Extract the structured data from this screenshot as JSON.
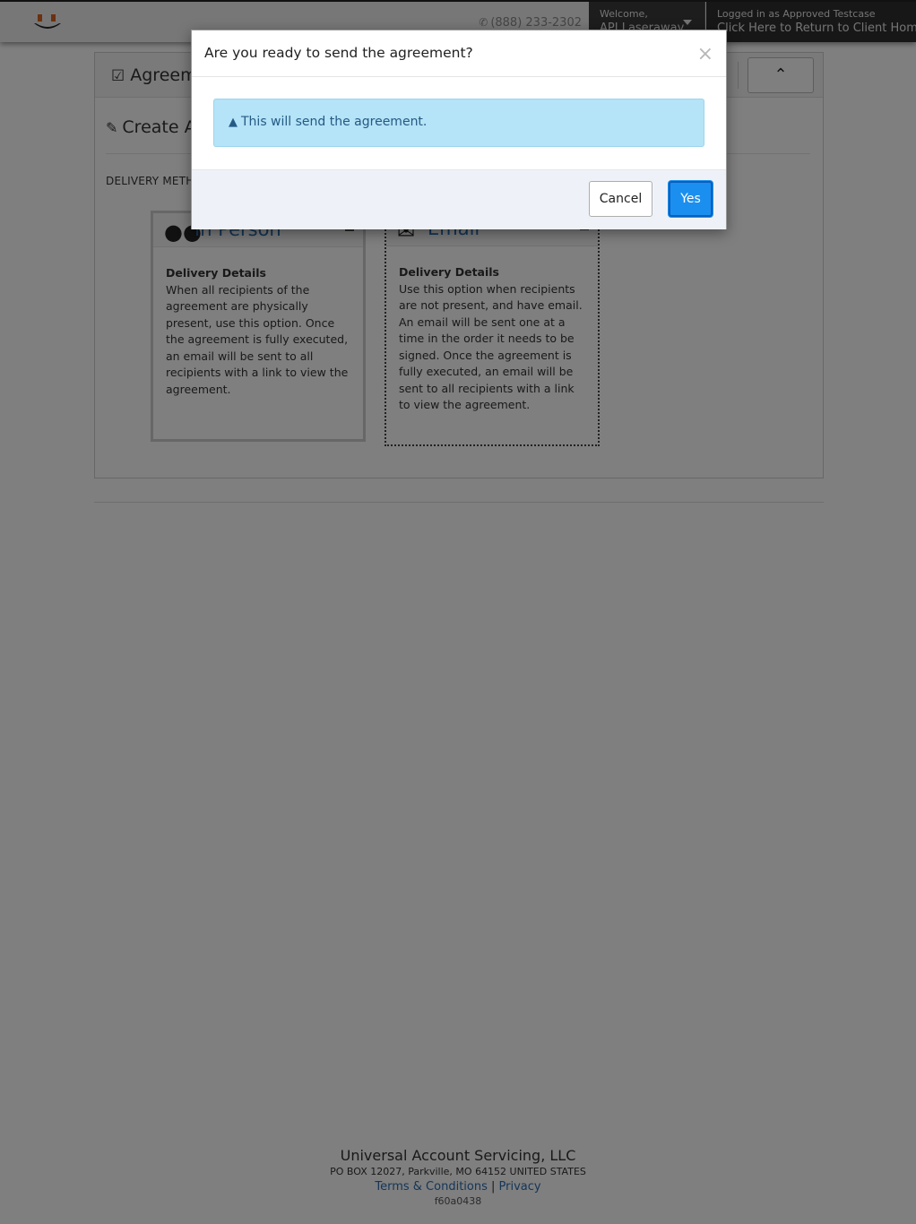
{
  "header": {
    "phone": "(888) 233-2302",
    "welcome_label": "Welcome,",
    "user_name": "API Laseraway",
    "logged_in_label": "Logged in as Approved Testcase",
    "return_link": "Click Here to Return to Client Home"
  },
  "panel": {
    "title": "Agreements",
    "subtitle": "Create Agreement",
    "delivery_label": "DELIVERY METHOD"
  },
  "cards": [
    {
      "title": "In Person",
      "details_label": "Delivery Details",
      "description": "When all recipients of the agreement are physically present, use this option. Once the agreement is fully executed, an email will be sent to all recipients with a link to view the agreement.",
      "icon": "users-icon"
    },
    {
      "title": "Email",
      "details_label": "Delivery Details",
      "description": "Use this option when recipients are not present, and have email. An email will be sent one at a time in the order it needs to be signed. Once the agreement is fully executed, an email will be sent to all recipients with a link to view the agreement.",
      "icon": "envelope-icon"
    }
  ],
  "footer": {
    "company": "Universal Account Servicing, LLC",
    "address": "PO BOX 12027, Parkville, MO 64152 UNITED STATES",
    "terms": "Terms & Conditions",
    "separator": "|",
    "privacy": "Privacy",
    "version": "f60a0438"
  },
  "modal": {
    "title": "Are you ready to send the agreement?",
    "close_symbol": "×",
    "alert_text": "This will send the agreement.",
    "cancel_label": "Cancel",
    "yes_label": "Yes"
  },
  "colors": {
    "link": "#2b6cb0",
    "primary_button": "#1b8ff0",
    "alert_bg": "#b5e3f7",
    "alert_text": "#245a84",
    "topbar_dark": "#2f2f2f"
  }
}
